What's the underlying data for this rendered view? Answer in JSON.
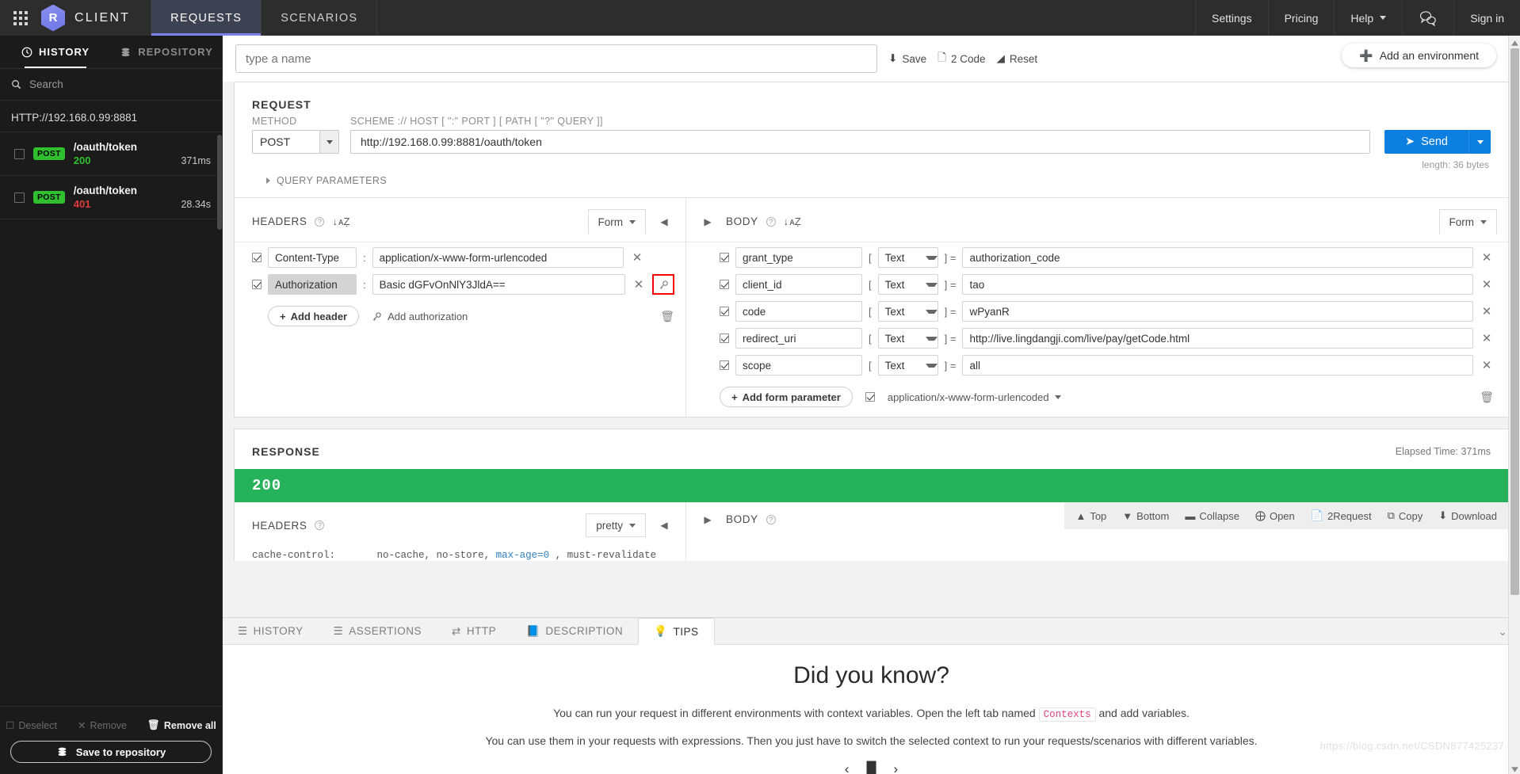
{
  "topnav": {
    "grid_icon": "apps-grid-icon",
    "logo_letter": "R",
    "brand": "CLIENT",
    "tabs": [
      {
        "label": "REQUESTS",
        "active": true
      },
      {
        "label": "SCENARIOS",
        "active": false
      }
    ],
    "right_items": [
      {
        "label": "Settings"
      },
      {
        "label": "Pricing"
      },
      {
        "label": "Help"
      },
      {
        "label": "Sign in"
      }
    ],
    "chat_icon": "chat-bubbles-icon",
    "accent": "#7b82ea",
    "background": "#2d2d2d"
  },
  "sidebar": {
    "tabs": [
      {
        "label": "HISTORY",
        "icon": "clock-icon",
        "active": true
      },
      {
        "label": "REPOSITORY",
        "icon": "database-icon",
        "active": false
      }
    ],
    "search_placeholder": "Search",
    "search_icon": "search-icon",
    "host_group": "HTTP://192.168.0.99:8881",
    "entries": [
      {
        "method": "POST",
        "path": "/oauth/token",
        "status": "200",
        "status_color": "#31c031",
        "time": "371ms"
      },
      {
        "method": "POST",
        "path": "/oauth/token",
        "status": "401",
        "status_color": "#e03b3b",
        "time": "28.34s"
      }
    ],
    "footer": {
      "deselect": "Deselect",
      "remove": "Remove",
      "remove_all": "Remove all",
      "save_to_repository": "Save to repository"
    }
  },
  "topbar": {
    "name_value": "",
    "name_placeholder": "type a name",
    "save_label": "Save",
    "code_label": "2 Code",
    "reset_label": "Reset",
    "add_environment": "Add an environment"
  },
  "request": {
    "section_title": "REQUEST",
    "method_label": "METHOD",
    "method_value": "POST",
    "url_label": "SCHEME :// HOST [ \":\" PORT ] [ PATH [ \"?\" QUERY ]]",
    "url_value": "http://192.168.0.99:8881/oauth/token",
    "send_label": "Send",
    "length_note": "length: 36 bytes",
    "query_parameters": "QUERY PARAMETERS",
    "headers": {
      "title": "HEADERS",
      "mode": "Form",
      "rows": [
        {
          "checked": true,
          "name": "Content-Type",
          "value": "application/x-www-form-urlencoded",
          "selected": false,
          "has_magnifier": false
        },
        {
          "checked": true,
          "name": "Authorization",
          "value": "Basic dGFvOnNlY3JldA==",
          "selected": true,
          "has_magnifier": true
        }
      ],
      "add_header": "Add header",
      "add_authorization": "Add authorization"
    },
    "body": {
      "title": "BODY",
      "mode": "Form",
      "rows": [
        {
          "checked": true,
          "name": "grant_type",
          "type": "Text",
          "value": "authorization_code"
        },
        {
          "checked": true,
          "name": "client_id",
          "type": "Text",
          "value": "tao"
        },
        {
          "checked": true,
          "name": "code",
          "type": "Text",
          "value": "wPyanR"
        },
        {
          "checked": true,
          "name": "redirect_uri",
          "type": "Text",
          "value": "http://live.lingdangji.com/live/pay/getCode.html"
        },
        {
          "checked": true,
          "name": "scope",
          "type": "Text",
          "value": "all"
        }
      ],
      "add_form_parameter": "Add form parameter",
      "content_type": "application/x-www-form-urlencoded",
      "content_type_checked": true
    }
  },
  "response": {
    "section_title": "RESPONSE",
    "elapsed": "Elapsed Time: 371ms",
    "status_code": "200",
    "status_color": "#26b15b",
    "headers_title": "HEADERS",
    "headers_mode": "pretty",
    "body_title": "BODY",
    "header_line_key": "cache-control:",
    "header_line_val_a": "no-cache, no-store,",
    "header_line_val_b": "max-age=0",
    "header_line_val_c": ", must-revalidate",
    "toolbar": [
      {
        "label": "Top",
        "icon": "arrow-up-circle-icon"
      },
      {
        "label": "Bottom",
        "icon": "arrow-down-circle-icon"
      },
      {
        "label": "Collapse",
        "icon": "minus-square-icon"
      },
      {
        "label": "Open",
        "icon": "plus-square-icon"
      },
      {
        "label": "2Request",
        "icon": "copy-to-request-icon"
      },
      {
        "label": "Copy",
        "icon": "copy-icon"
      },
      {
        "label": "Download",
        "icon": "download-icon"
      }
    ]
  },
  "bottom": {
    "tabs": [
      {
        "label": "HISTORY",
        "icon": "list-icon",
        "active": false
      },
      {
        "label": "ASSERTIONS",
        "icon": "assertions-icon",
        "active": false
      },
      {
        "label": "HTTP",
        "icon": "exchange-icon",
        "active": false
      },
      {
        "label": "DESCRIPTION",
        "icon": "book-icon",
        "active": false
      },
      {
        "label": "TIPS",
        "icon": "lightbulb-icon",
        "active": true
      }
    ],
    "tips": {
      "title": "Did you know?",
      "line1_a": "You can run your request in different environments with context variables. Open the left tab named",
      "line1_chip": "Contexts",
      "line1_b": "and add variables.",
      "line2": "You can use them in your requests with expressions. Then you just have to switch the selected context to run your requests/scenarios with different variables."
    },
    "carousel": {
      "prev": "‹",
      "pause": "▐▌",
      "next": "›"
    },
    "watermark": "https://blog.csdn.net/CSDN877425237"
  }
}
